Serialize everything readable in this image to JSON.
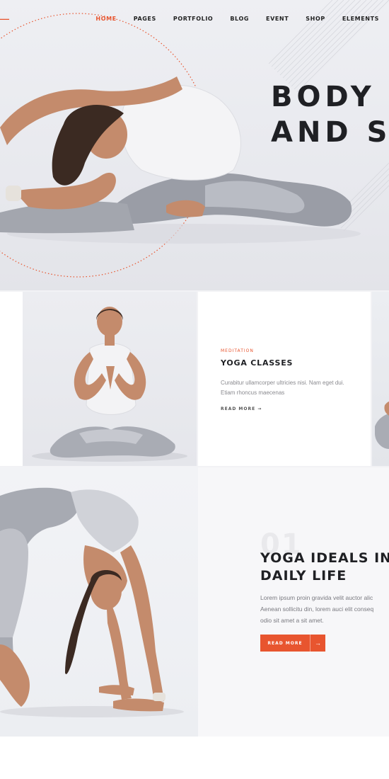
{
  "nav": {
    "items": [
      {
        "label": "HOME",
        "active": true
      },
      {
        "label": "PAGES",
        "active": false
      },
      {
        "label": "PORTFOLIO",
        "active": false
      },
      {
        "label": "BLOG",
        "active": false
      },
      {
        "label": "EVENT",
        "active": false
      },
      {
        "label": "SHOP",
        "active": false
      },
      {
        "label": "ELEMENTS",
        "active": false
      }
    ]
  },
  "hero": {
    "title_line1": "BODY",
    "title_line2": "AND SO"
  },
  "feature": {
    "category": "MEDITATION",
    "title": "YOGA CLASSES",
    "text": "Curabitur ullamcorper ultricies nisi. Nam eget dui. Etiam rhoncus maecenas",
    "link_label": "READ MORE"
  },
  "ideal": {
    "number": "01",
    "title_line1": "YOGA IDEALS IN",
    "title_line2": "DAILY LIFE",
    "text_lines": [
      "Lorem ipsum proin gravida velit auctor alic",
      "Aenean sollicitu din, lorem auci elit conseq",
      "odio sit amet a sit amet."
    ],
    "button_label": "READ MORE"
  },
  "colors": {
    "accent": "#e8552f",
    "heading": "#1f2024",
    "body_text": "#8a8a8f"
  },
  "icons": {
    "brand": "brand-mark-icon",
    "link_arrow": "arrow-right-icon",
    "button_arrow": "arrow-right-icon"
  }
}
